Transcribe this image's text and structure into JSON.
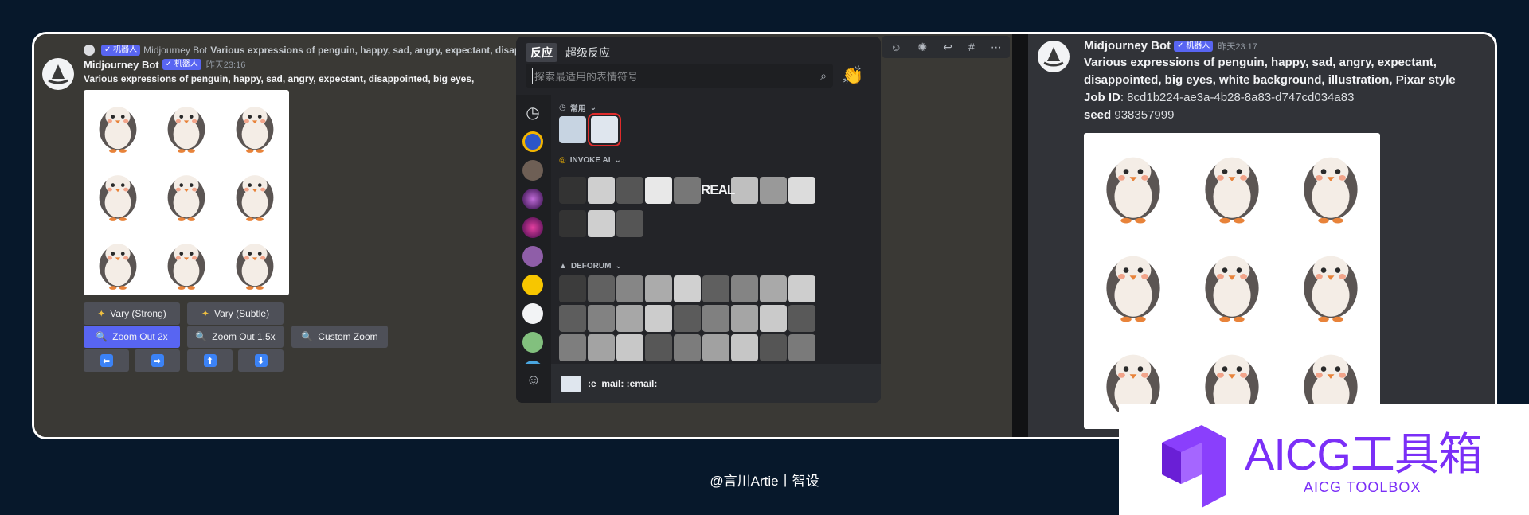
{
  "left_message": {
    "reply_badge": "✓ 机器人",
    "reply_author": "Midjourney Bot",
    "reply_text": "Various expressions of penguin, happy, sad, angry, expectant, disappo",
    "author": "Midjourney Bot",
    "badge": "✓ 机器人",
    "timestamp": "昨天23:16",
    "prompt": "Various expressions of penguin, happy, sad, angry, expectant, disappointed, big eyes,",
    "buttons_row1": [
      "Vary (Strong)",
      "Vary (Subtle)"
    ],
    "buttons_row2": [
      "Zoom Out 2x",
      "Zoom Out 1.5x",
      "Custom Zoom"
    ],
    "arrows": [
      "⬅",
      "➡",
      "⬆",
      "⬇"
    ]
  },
  "picker": {
    "tab_reaction": "反应",
    "tab_super": "超级反应",
    "search_placeholder": "探索最适用的表情符号",
    "cat_frequent": "常用",
    "cat_invoke": "INVOKE AI",
    "cat_deforum": "DEFORUM",
    "invoke_text": "REAL",
    "footer_text": ":e_mail: :email:"
  },
  "right_message": {
    "author": "Midjourney Bot",
    "badge": "✓ 机器人",
    "timestamp": "昨天23:17",
    "prompt_line1": "Various expressions of penguin, happy, sad, angry, expectant,",
    "prompt_line2": "disappointed, big eyes, white background, illustration, Pixar style",
    "jobid_label": "Job ID",
    "jobid_value": ": 8cd1b224-ae3a-4b28-8a83-d747cd034a83",
    "seed_label": "seed",
    "seed_value": " 938357999"
  },
  "footer": {
    "credit": "@言川Artie丨智设"
  },
  "brand": {
    "title": "AICG工具箱",
    "subtitle": "AICG TOOLBOX"
  },
  "colors": {
    "accent": "#5865f2",
    "brand_purple": "#7b2ff7",
    "bg": "#07182b"
  }
}
